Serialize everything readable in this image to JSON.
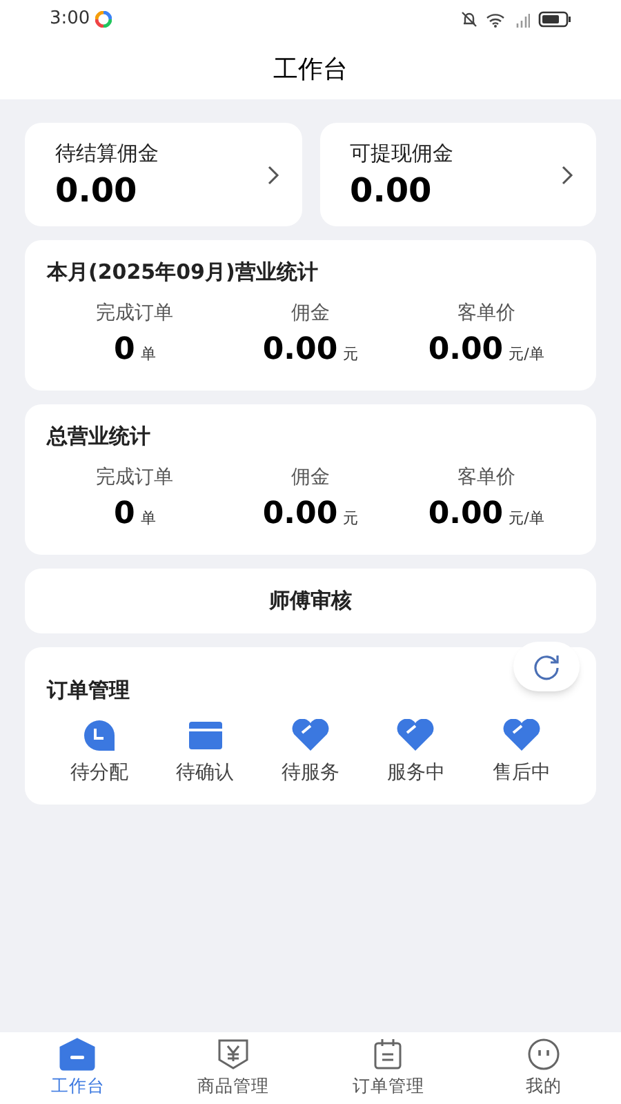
{
  "status_bar": {
    "time": "3:00"
  },
  "header": {
    "title": "工作台"
  },
  "commission_cards": [
    {
      "label": "待结算佣金",
      "amount": "0.00"
    },
    {
      "label": "可提现佣金",
      "amount": "0.00"
    }
  ],
  "stat_sections": [
    {
      "title": "本月(2025年09月)营业统计",
      "metrics": [
        {
          "label": "完成订单",
          "value": "0",
          "unit": "单"
        },
        {
          "label": "佣金",
          "value": "0.00",
          "unit": "元"
        },
        {
          "label": "客单价",
          "value": "0.00",
          "unit": "元/单"
        }
      ]
    },
    {
      "title": "总营业统计",
      "metrics": [
        {
          "label": "完成订单",
          "value": "0",
          "unit": "单"
        },
        {
          "label": "佣金",
          "value": "0.00",
          "unit": "元"
        },
        {
          "label": "客单价",
          "value": "0.00",
          "unit": "元/单"
        }
      ]
    }
  ],
  "review_button": {
    "label": "师傅审核"
  },
  "order_management": {
    "title": "订单管理",
    "items": [
      {
        "label": "待分配",
        "kind": "clock"
      },
      {
        "label": "待确认",
        "kind": "card"
      },
      {
        "label": "待服务",
        "kind": "heart"
      },
      {
        "label": "服务中",
        "kind": "heart"
      },
      {
        "label": "售后中",
        "kind": "heart"
      }
    ]
  },
  "bottom_nav": [
    {
      "label": "工作台",
      "kind": "home",
      "selected": true
    },
    {
      "label": "商品管理",
      "kind": "goods",
      "selected": false
    },
    {
      "label": "订单管理",
      "kind": "calendar",
      "selected": false
    },
    {
      "label": "我的",
      "kind": "face",
      "selected": false
    }
  ]
}
